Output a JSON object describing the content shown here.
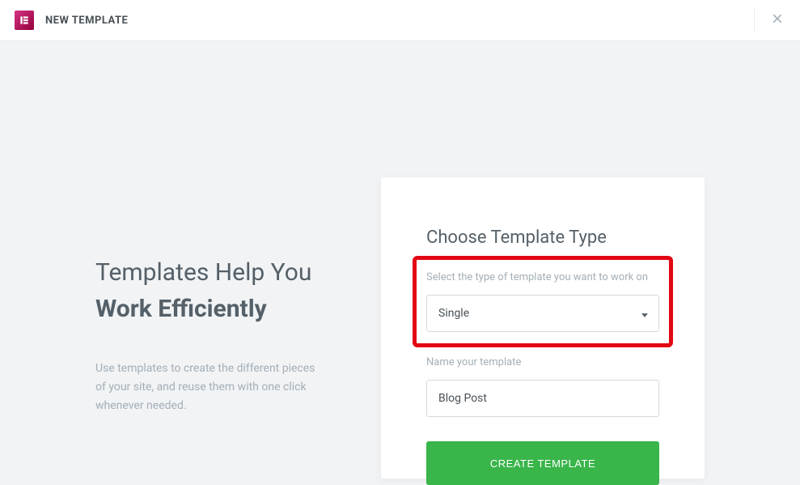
{
  "header": {
    "title": "NEW TEMPLATE"
  },
  "left": {
    "headline_part1": "Templates Help You ",
    "headline_strong": "Work Efficiently",
    "description": "Use templates to create the different pieces of your site, and reuse them with one click whenever needed."
  },
  "form": {
    "title": "Choose Template Type",
    "type_label": "Select the type of template you want to work on",
    "type_value": "Single",
    "name_label": "Name your template",
    "name_value": "Blog Post",
    "submit_label": "CREATE TEMPLATE"
  }
}
